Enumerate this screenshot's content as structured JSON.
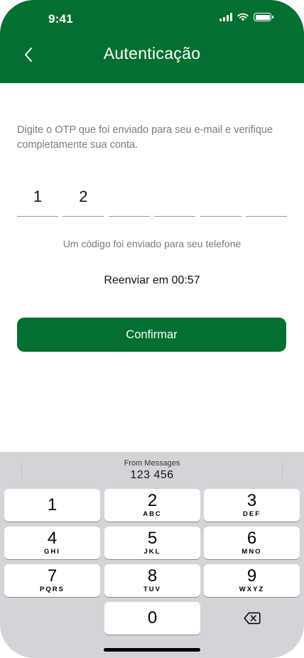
{
  "status_bar": {
    "time": "9:41"
  },
  "header": {
    "title": "Autenticação"
  },
  "instructions": "Digite o OTP que foi enviado para seu e-mail e verifique completamente sua conta.",
  "otp": {
    "digits": [
      "1",
      "2",
      "",
      "",
      "",
      ""
    ]
  },
  "code_sent_text": "Um código foi enviado para seu telefone",
  "resend_text": "Reenviar em 00:57",
  "confirm_button_label": "Confirmar",
  "keyboard": {
    "suggestion_source": "From Messages",
    "suggestion_code": "123 456",
    "keys": [
      {
        "num": "1",
        "letters": ""
      },
      {
        "num": "2",
        "letters": "ABC"
      },
      {
        "num": "3",
        "letters": "DEF"
      },
      {
        "num": "4",
        "letters": "GHI"
      },
      {
        "num": "5",
        "letters": "JKL"
      },
      {
        "num": "6",
        "letters": "MNO"
      },
      {
        "num": "7",
        "letters": "PQRS"
      },
      {
        "num": "8",
        "letters": "TUV"
      },
      {
        "num": "9",
        "letters": "WXYZ"
      },
      {
        "num": "0",
        "letters": ""
      }
    ]
  },
  "colors": {
    "brand_green": "#03702f",
    "keyboard_bg": "#d2d4d8"
  },
  "icons": {
    "back": "chevron-left-icon",
    "delete": "backspace-icon",
    "signal": "cellular-signal-icon",
    "wifi": "wifi-icon",
    "battery": "battery-icon"
  }
}
